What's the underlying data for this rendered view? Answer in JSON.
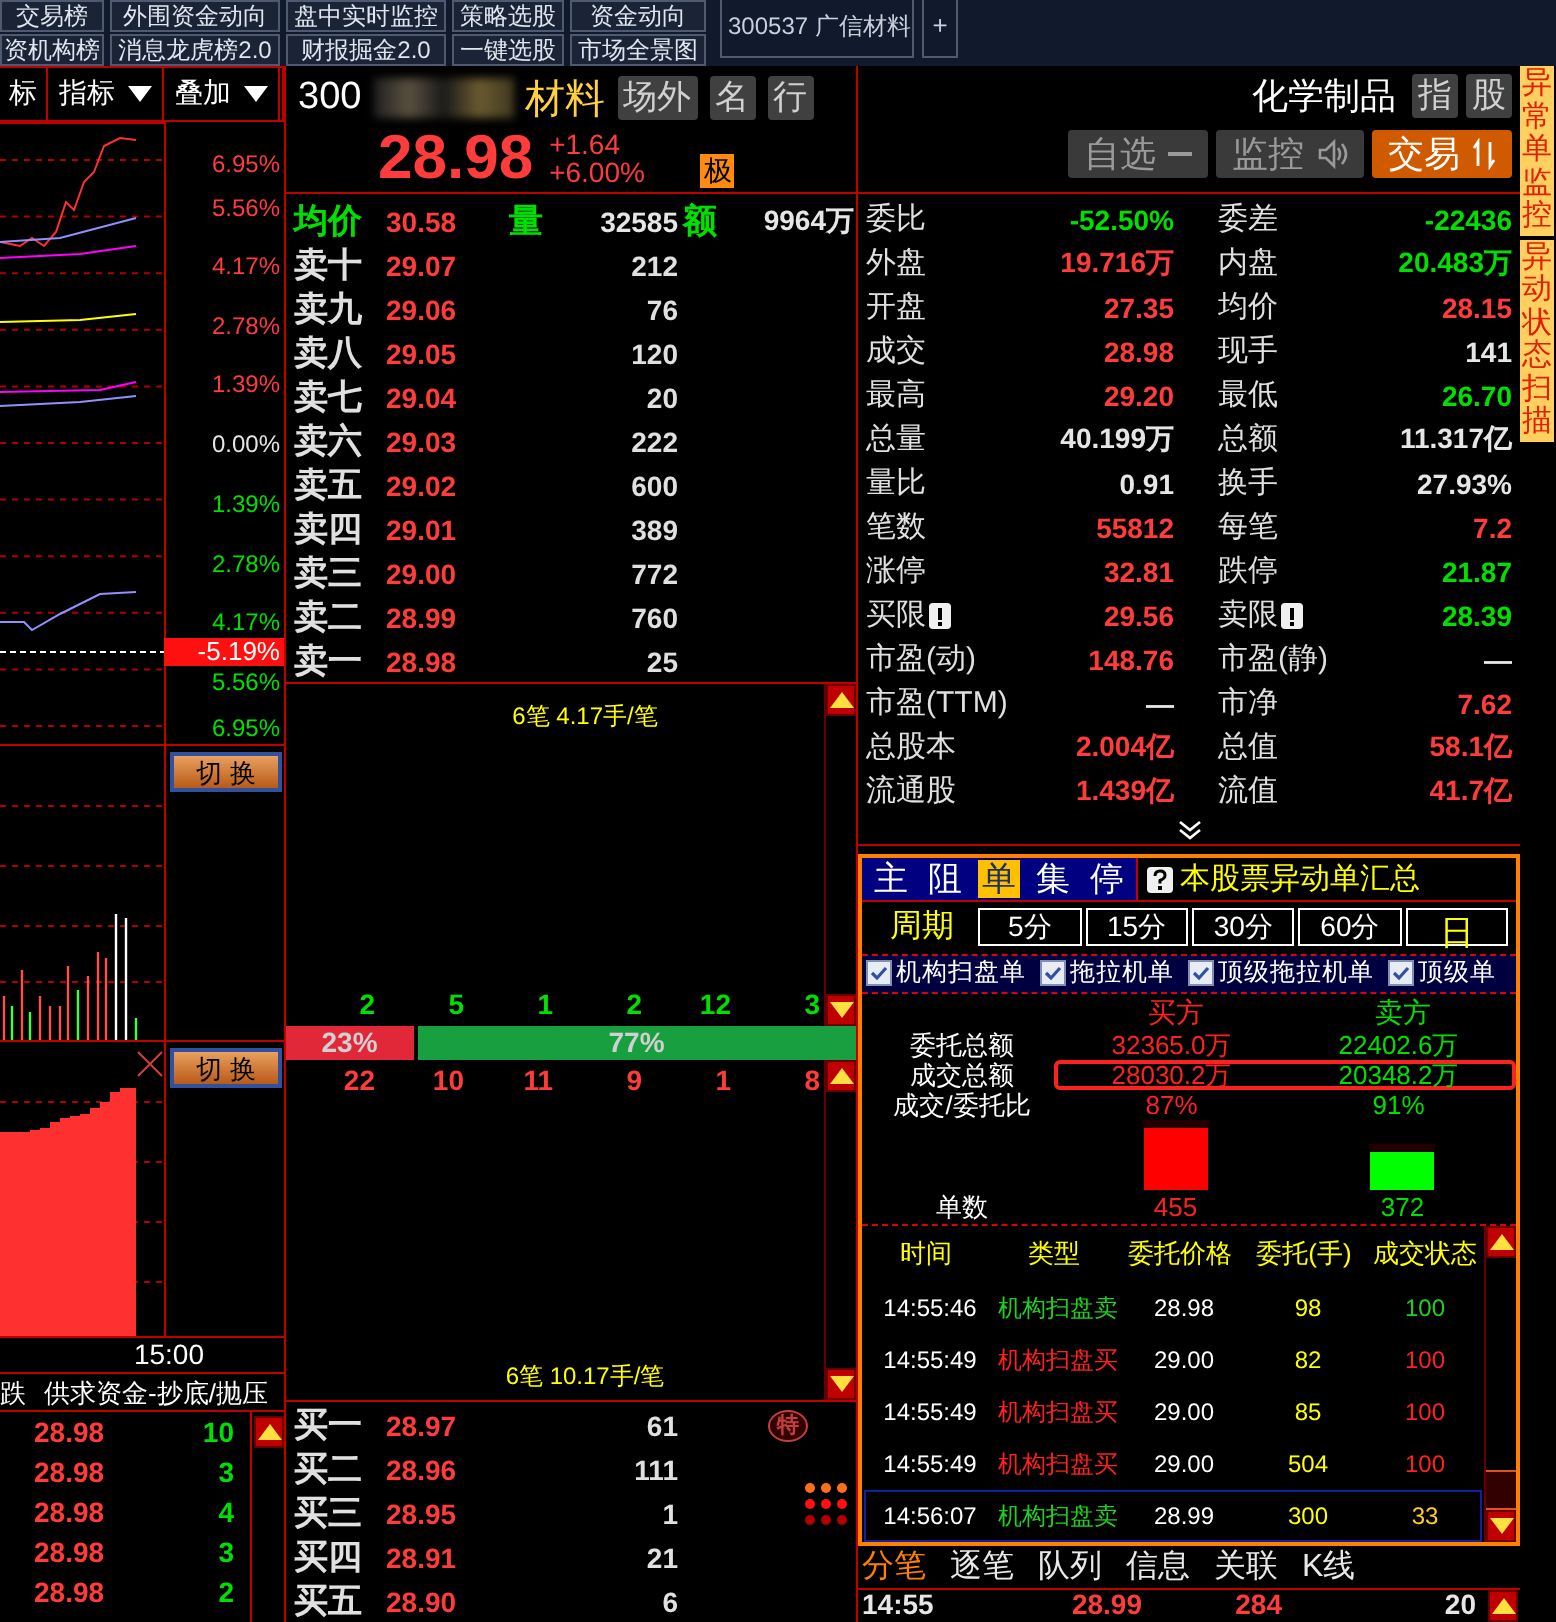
{
  "top_nav": {
    "rows": [
      [
        "交易榜",
        "外围资金动向",
        "盘中实时监控",
        "策略选股",
        "资金动向"
      ],
      [
        "资机构榜",
        "消息龙虎榜2.0",
        "财报掘金2.0",
        "一键选股",
        "市场全景图"
      ]
    ]
  },
  "stock_tab": "300537 广信材料",
  "add_tab": "+",
  "chart": {
    "toolbar": [
      {
        "label": "标",
        "dropdown": false
      },
      {
        "label": "指标",
        "dropdown": true
      },
      {
        "label": "叠加",
        "dropdown": true
      }
    ],
    "axis": [
      {
        "label": "6.95%",
        "color": "#ff3c3c"
      },
      {
        "label": "5.56%",
        "color": "#ff3c3c"
      },
      {
        "label": "4.17%",
        "color": "#ff3c3c"
      },
      {
        "label": "2.78%",
        "color": "#ff3c3c"
      },
      {
        "label": "1.39%",
        "color": "#ff3c3c"
      },
      {
        "label": "0.00%",
        "color": "#e6e6e6"
      },
      {
        "label": "1.39%",
        "color": "#00e000"
      },
      {
        "label": "2.78%",
        "color": "#00e000"
      },
      {
        "label": "4.17%",
        "color": "#00e000"
      },
      {
        "label": "5.56%",
        "color": "#00e000"
      },
      {
        "label": "6.95%",
        "color": "#00e000"
      }
    ],
    "current": "-5.19%",
    "switch_buttons": [
      "切 换",
      "切 换"
    ],
    "time": "15:00"
  },
  "flow": {
    "headers": [
      "跌",
      "供求资金-抄底/抛压"
    ],
    "rows": [
      {
        "price": "28.98",
        "count": "10"
      },
      {
        "price": "28.98",
        "count": "3"
      },
      {
        "price": "28.98",
        "count": "4"
      },
      {
        "price": "28.98",
        "count": "3"
      },
      {
        "price": "28.98",
        "count": "2"
      }
    ]
  },
  "quote": {
    "code": "300",
    "name": "材料",
    "tags": [
      "场外",
      "名",
      "行"
    ],
    "price": "28.98",
    "change": "+1.64",
    "change_pct": "+6.00%",
    "badge": "极",
    "industry": "化学制品",
    "industry_tags": [
      "指",
      "股"
    ],
    "actions": [
      {
        "label": "自选",
        "kind": "remove"
      },
      {
        "label": "监控",
        "kind": "monitor"
      },
      {
        "label": "交易",
        "kind": "trade"
      }
    ]
  },
  "book": {
    "summary": [
      {
        "label": "均价",
        "value": "30.58",
        "color": "#ff3c3c"
      },
      {
        "label": "量",
        "value": "32585",
        "color": "#e6e6e6"
      },
      {
        "label": "额",
        "value": "9964万",
        "color": "#e6e6e6"
      }
    ],
    "asks": [
      {
        "label": "卖十",
        "price": "29.07",
        "volume": "212"
      },
      {
        "label": "卖九",
        "price": "29.06",
        "volume": "76"
      },
      {
        "label": "卖八",
        "price": "29.05",
        "volume": "120"
      },
      {
        "label": "卖七",
        "price": "29.04",
        "volume": "20"
      },
      {
        "label": "卖六",
        "price": "29.03",
        "volume": "222"
      },
      {
        "label": "卖五",
        "price": "29.02",
        "volume": "600"
      },
      {
        "label": "卖四",
        "price": "29.01",
        "volume": "389"
      },
      {
        "label": "卖三",
        "price": "29.00",
        "volume": "772"
      },
      {
        "label": "卖二",
        "price": "28.99",
        "volume": "760"
      },
      {
        "label": "卖一",
        "price": "28.98",
        "volume": "25"
      }
    ],
    "bids": [
      {
        "label": "买一",
        "price": "28.97",
        "volume": "61",
        "badge": "特"
      },
      {
        "label": "买二",
        "price": "28.96",
        "volume": "111"
      },
      {
        "label": "买三",
        "price": "28.95",
        "volume": "1"
      },
      {
        "label": "买四",
        "price": "28.91",
        "volume": "21"
      },
      {
        "label": "买五",
        "price": "28.90",
        "volume": "6"
      }
    ]
  },
  "ticks": {
    "top_note": "6笔 4.17手/笔",
    "sell_counts": [
      "2",
      "5",
      "1",
      "2",
      "12",
      "3"
    ],
    "ratio": {
      "buy": "23%",
      "sell": "77%"
    },
    "buy_counts": [
      "22",
      "10",
      "11",
      "9",
      "1",
      "8"
    ],
    "bottom_note": "6笔 10.17手/笔"
  },
  "stats": [
    {
      "label": "委比",
      "value": "-52.50%",
      "color": "#00e000",
      "alert": false
    },
    {
      "label": "委差",
      "value": "-22436",
      "color": "#00e000",
      "alert": false
    },
    {
      "label": "外盘",
      "value": "19.716万",
      "color": "#ff3c3c",
      "alert": false
    },
    {
      "label": "内盘",
      "value": "20.483万",
      "color": "#00e000",
      "alert": false
    },
    {
      "label": "开盘",
      "value": "27.35",
      "color": "#ff3c3c",
      "alert": false
    },
    {
      "label": "均价",
      "value": "28.15",
      "color": "#ff3c3c",
      "alert": false
    },
    {
      "label": "成交",
      "value": "28.98",
      "color": "#ff3c3c",
      "alert": false
    },
    {
      "label": "现手",
      "value": "141",
      "color": "#e6e6e6",
      "alert": false
    },
    {
      "label": "最高",
      "value": "29.20",
      "color": "#ff3c3c",
      "alert": false
    },
    {
      "label": "最低",
      "value": "26.70",
      "color": "#00e000",
      "alert": false
    },
    {
      "label": "总量",
      "value": "40.199万",
      "color": "#e6e6e6",
      "alert": false
    },
    {
      "label": "总额",
      "value": "11.317亿",
      "color": "#e6e6e6",
      "alert": false
    },
    {
      "label": "量比",
      "value": "0.91",
      "color": "#e6e6e6",
      "alert": false
    },
    {
      "label": "换手",
      "value": "27.93%",
      "color": "#e6e6e6",
      "alert": false
    },
    {
      "label": "笔数",
      "value": "55812",
      "color": "#ff3c3c",
      "alert": false
    },
    {
      "label": "每笔",
      "value": "7.2",
      "color": "#ff3c3c",
      "alert": false
    },
    {
      "label": "涨停",
      "value": "32.81",
      "color": "#ff3c3c",
      "alert": false
    },
    {
      "label": "跌停",
      "value": "21.87",
      "color": "#00e000",
      "alert": false
    },
    {
      "label": "买限",
      "value": "29.56",
      "color": "#ff3c3c",
      "alert": true
    },
    {
      "label": "卖限",
      "value": "28.39",
      "color": "#00e000",
      "alert": true
    },
    {
      "label": "市盈(动)",
      "value": "148.76",
      "color": "#ff3c3c",
      "alert": false
    },
    {
      "label": "市盈(静)",
      "value": "—",
      "color": "#e6e6e6",
      "alert": false
    },
    {
      "label": "市盈(TTM)",
      "value": "—",
      "color": "#e6e6e6",
      "alert": false
    },
    {
      "label": "市净",
      "value": "7.62",
      "color": "#ff3c3c",
      "alert": false
    },
    {
      "label": "总股本",
      "value": "2.004亿",
      "color": "#ff3c3c",
      "alert": false
    },
    {
      "label": "总值",
      "value": "58.1亿",
      "color": "#ff3c3c",
      "alert": false
    },
    {
      "label": "流通股",
      "value": "1.439亿",
      "color": "#ff3c3c",
      "alert": false
    },
    {
      "label": "流值",
      "value": "41.7亿",
      "color": "#ff3c3c",
      "alert": false
    }
  ],
  "anomaly": {
    "tabs": [
      {
        "label": "主",
        "selected": false
      },
      {
        "label": "阻",
        "selected": false
      },
      {
        "label": "单",
        "selected": true
      },
      {
        "label": "集",
        "selected": false
      },
      {
        "label": "停",
        "selected": false
      }
    ],
    "title": "本股票异动单汇总",
    "period_label": "周期",
    "periods": [
      {
        "label": "5分",
        "selected": false
      },
      {
        "label": "15分",
        "selected": false
      },
      {
        "label": "30分",
        "selected": false
      },
      {
        "label": "60分",
        "selected": false
      },
      {
        "label": "日",
        "selected": true
      }
    ],
    "filters": [
      {
        "label": "机构扫盘单",
        "checked": true
      },
      {
        "label": "拖拉机单",
        "checked": true
      },
      {
        "label": "顶级拖拉机单",
        "checked": true
      },
      {
        "label": "顶级单",
        "checked": true
      }
    ],
    "buy_header": "买方",
    "sell_header": "卖方",
    "summary_rows": [
      {
        "label": "委托总额",
        "buy": "32365.0万",
        "sell": "22402.6万",
        "highlighted": false
      },
      {
        "label": "成交总额",
        "buy": "28030.2万",
        "sell": "20348.2万",
        "highlighted": true
      },
      {
        "label": "成交/委托比",
        "buy": "87%",
        "sell": "91%",
        "highlighted": false
      }
    ],
    "count_label": "单数",
    "buy_count": "455",
    "sell_count": "372",
    "columns": [
      "时间",
      "类型",
      "委托价格",
      "委托(手)",
      "成交状态"
    ],
    "trades": [
      {
        "time": "14:55:46",
        "type": "机构扫盘卖",
        "color": "#20d020",
        "price": "28.98",
        "lots": "98",
        "status": "100",
        "partial": false,
        "selected": false
      },
      {
        "time": "14:55:49",
        "type": "机构扫盘买",
        "color": "#ff2020",
        "price": "29.00",
        "lots": "82",
        "status": "100",
        "partial": false,
        "selected": false
      },
      {
        "time": "14:55:49",
        "type": "机构扫盘买",
        "color": "#ff2020",
        "price": "29.00",
        "lots": "85",
        "status": "100",
        "partial": false,
        "selected": false
      },
      {
        "time": "14:55:49",
        "type": "机构扫盘买",
        "color": "#ff2020",
        "price": "29.00",
        "lots": "504",
        "status": "100",
        "partial": false,
        "selected": false
      },
      {
        "time": "14:56:07",
        "type": "机构扫盘卖",
        "color": "#20d020",
        "price": "28.99",
        "lots": "300",
        "status": "33",
        "partial": true,
        "selected": true
      }
    ]
  },
  "bottom_tabs": [
    {
      "label": "分笔",
      "selected": true
    },
    {
      "label": "逐笔",
      "selected": false
    },
    {
      "label": "队列",
      "selected": false
    },
    {
      "label": "信息",
      "selected": false
    },
    {
      "label": "关联",
      "selected": false
    },
    {
      "label": "K线",
      "selected": false
    }
  ],
  "last_tick": [
    {
      "text": "14:55",
      "color": "#e6e6e6"
    },
    {
      "text": "28.99",
      "color": "#ff3c3c"
    },
    {
      "text": "284",
      "color": "#ff3c3c"
    },
    {
      "text": "20",
      "color": "#e6e6e6"
    }
  ],
  "side_tabs": [
    "异常单监控",
    "异动状态扫描"
  ]
}
